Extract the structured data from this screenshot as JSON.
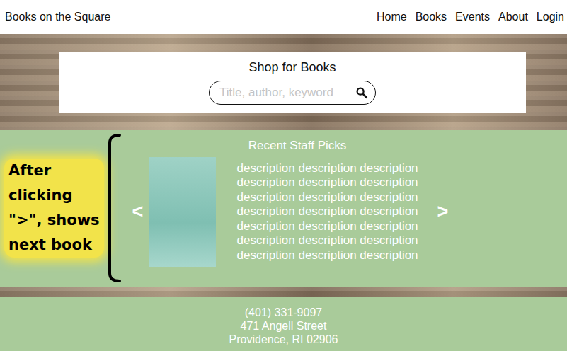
{
  "header": {
    "logo": "Books on the Square",
    "nav": [
      "Home",
      "Books",
      "Events",
      "About",
      "Login"
    ]
  },
  "search": {
    "title": "Shop for Books",
    "placeholder": "Title, author, keyword"
  },
  "annotation": {
    "lines": [
      "After",
      "clicking",
      "\">\", shows",
      "next book"
    ]
  },
  "staff_picks": {
    "title": "Recent Staff Picks",
    "prev": "<",
    "next": ">",
    "book": {
      "description": [
        "description description description",
        "description description description",
        "description description description",
        "description description description",
        "description description description",
        "description description description",
        "description description description"
      ]
    }
  },
  "footer": {
    "lines": [
      "(401) 331-9097",
      "471 Angell Street",
      "Providence, RI 02906"
    ]
  }
}
